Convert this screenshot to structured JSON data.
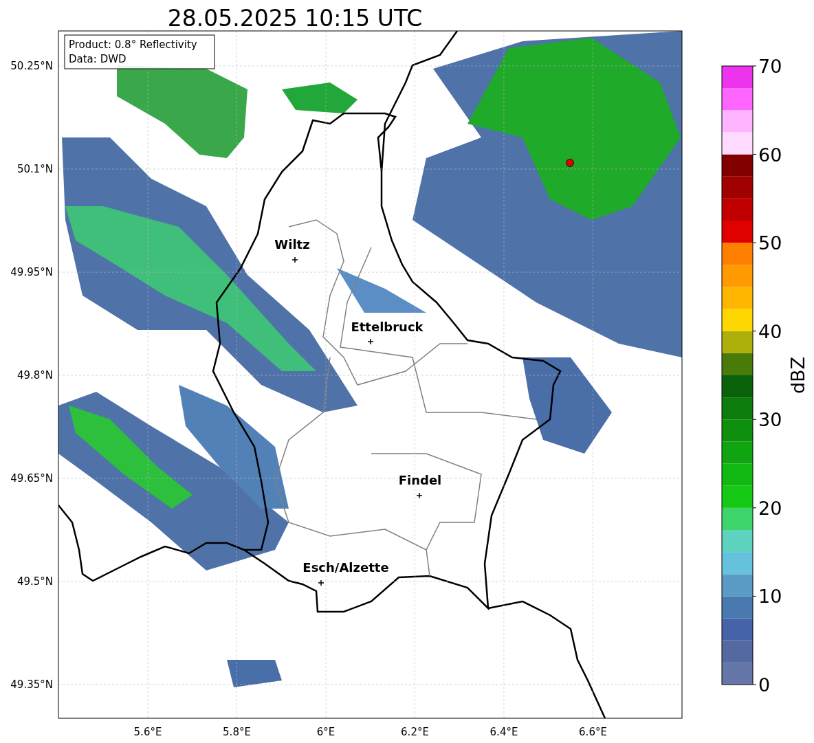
{
  "title": "28.05.2025 10:15 UTC",
  "info_box": [
    "Product: 0.8° Reflectivity",
    "Data: DWD"
  ],
  "y_ticks": [
    "50.25°N",
    "50.1°N",
    "49.95°N",
    "49.8°N",
    "49.65°N",
    "49.5°N",
    "49.35°N"
  ],
  "x_ticks": [
    "5.6°E",
    "5.8°E",
    "6°E",
    "6.2°E",
    "6.4°E",
    "6.6°E"
  ],
  "cities": [
    {
      "name": "Wiltz"
    },
    {
      "name": "Ettelbruck"
    },
    {
      "name": "Findel"
    },
    {
      "name": "Esch/Alzette"
    }
  ],
  "colorbar": {
    "label": "dBZ",
    "ticks": [
      "70",
      "60",
      "50",
      "40",
      "30",
      "20",
      "10",
      "0"
    ],
    "segments": [
      {
        "color": "#6577a8"
      },
      {
        "color": "#53699f"
      },
      {
        "color": "#4662a8"
      },
      {
        "color": "#4a79b0"
      },
      {
        "color": "#5a9cc6"
      },
      {
        "color": "#66c2dc"
      },
      {
        "color": "#5ed4c0"
      },
      {
        "color": "#3dd56b"
      },
      {
        "color": "#14c814"
      },
      {
        "color": "#12b812"
      },
      {
        "color": "#10a510"
      },
      {
        "color": "#0e900e"
      },
      {
        "color": "#0c7c0c"
      },
      {
        "color": "#0a620a"
      },
      {
        "color": "#4a7a0a"
      },
      {
        "color": "#adb00a"
      },
      {
        "color": "#ffd700"
      },
      {
        "color": "#ffb600"
      },
      {
        "color": "#ff9a00"
      },
      {
        "color": "#ff7f00"
      },
      {
        "color": "#e00000"
      },
      {
        "color": "#c00000"
      },
      {
        "color": "#a00000"
      },
      {
        "color": "#800000"
      },
      {
        "color": "#ffdcff"
      },
      {
        "color": "#ffb4ff"
      },
      {
        "color": "#ff66ff"
      },
      {
        "color": "#ee33ee"
      }
    ]
  }
}
